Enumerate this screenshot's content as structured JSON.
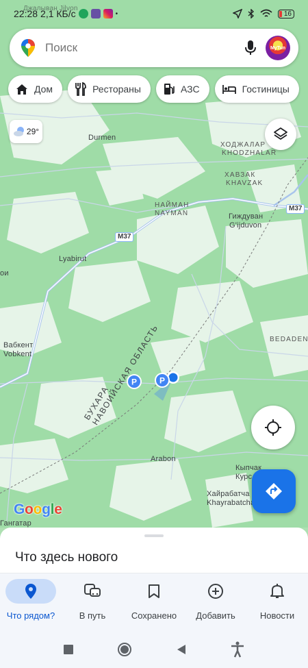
{
  "status_bar": {
    "time": "22:28",
    "speed": "2,1 КБ/с",
    "battery": "16",
    "overlay_text": "Джалыван Jilvon"
  },
  "search": {
    "placeholder": "Поиск"
  },
  "avatar": {
    "text": "MyTun"
  },
  "chips": [
    {
      "label": "Дом",
      "icon": "home-icon"
    },
    {
      "label": "Рестораны",
      "icon": "restaurant-icon"
    },
    {
      "label": "АЗС",
      "icon": "gas-station-icon"
    },
    {
      "label": "Гостиницы",
      "icon": "hotel-icon"
    }
  ],
  "weather": {
    "temp": "29°"
  },
  "map": {
    "labels": {
      "durmen": "Durmen",
      "khodzhalar_ru": "ХОДЖАЛАР",
      "khodzhalar_en": "KHODZHALAR",
      "khavzak_ru": "ХАВЗАК",
      "khavzak_en": "KHAVZAK",
      "nayman_ru": "НАЙМАН",
      "nayman_en": "NAYMAN",
      "gijduvon_ru": "Гиждуван",
      "gijduvon_en": "G'ijduvon",
      "lyabirut": "Lyabirut",
      "vabkent_ru": "Вабкент",
      "vabkent_en": "Vobkent",
      "bedaden": "BEDADEN",
      "region_1": "БУХАРА",
      "region_2": "НАВОИЙСКАЯ ОБЛАСТЬ",
      "arabon": "Arabon",
      "kypchak_ru": "Кыпчак",
      "kypchak_en": "Курс",
      "khayrabatcha_ru": "Хайрабатча",
      "khayrabatcha_en": "Khayrabatcha",
      "gangatar": "Гангатар",
      "left_edge": "ои"
    },
    "road_badges": {
      "m37_a": "M37",
      "m37_b": "M37"
    }
  },
  "google_logo": {
    "g": "G",
    "o1": "o",
    "o2": "o",
    "g2": "g",
    "l": "l",
    "e": "e"
  },
  "sheet": {
    "title": "Что здесь нового"
  },
  "nav": [
    {
      "label": "Что рядом?",
      "icon": "location-pin-icon",
      "active": true
    },
    {
      "label": "В путь",
      "icon": "commute-icon",
      "active": false
    },
    {
      "label": "Сохранено",
      "icon": "bookmark-icon",
      "active": false
    },
    {
      "label": "Добавить",
      "icon": "add-circle-icon",
      "active": false
    },
    {
      "label": "Новости",
      "icon": "bell-icon",
      "active": false
    }
  ],
  "colors": {
    "accent": "#1a73e8",
    "map_bg": "#9fdca7",
    "map_light": "#e8f5ea"
  }
}
